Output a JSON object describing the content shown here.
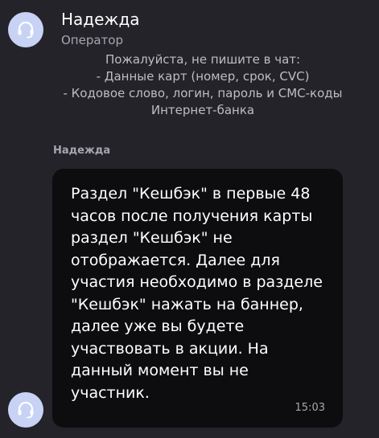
{
  "header": {
    "operator_name": "Надежда",
    "operator_role": "Оператор",
    "avatar_icon": "headset-icon"
  },
  "notice": {
    "lines": [
      "Пожалуйста, не пишите в чат:",
      "- Данные карт (номер, срок, CVC)",
      "- Кодовое слово, логин, пароль и СМС-коды",
      "Интернет-банка"
    ]
  },
  "message": {
    "sender": "Надежда",
    "lines": [
      "Раздел \"Кешбэк\" в первые 48",
      "часов после получения карты",
      "раздел \"Кешбэк\" не",
      "отображается. Далее для",
      "участия необходимо в разделе",
      "\"Кешбэк\" нажать на баннер,",
      "далее уже вы будете",
      "участвовать в акции. На",
      "данный момент вы не",
      "участник."
    ],
    "time": "15:03",
    "avatar_icon": "headset-icon"
  },
  "colors": {
    "background": "#232329",
    "bubble": "#0d0d0f",
    "avatar": "#c7d2f5",
    "muted_text": "#a6a6ae",
    "text": "#ffffff"
  }
}
